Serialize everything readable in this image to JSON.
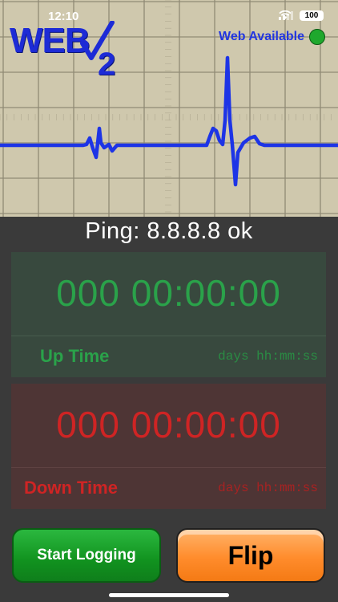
{
  "status_bar": {
    "time": "12:10",
    "battery": "100"
  },
  "header": {
    "logo_text": "WEB",
    "logo_subscript": "2",
    "web_status_label": "Web Available",
    "web_status_color": "#1fa82d"
  },
  "ping": {
    "text": "Ping: 8.8.8.8 ok"
  },
  "up_panel": {
    "value": "000 00:00:00",
    "label": "Up Time",
    "format": "days hh:mm:ss",
    "color": "#2aa24a"
  },
  "down_panel": {
    "value": "000 00:00:00",
    "label": "Down Time",
    "format": "days hh:mm:ss",
    "color": "#cf2424"
  },
  "buttons": {
    "start_label": "Start Logging",
    "flip_label": "Flip"
  },
  "icons": [
    "wifi-icon",
    "signal-icon",
    "battery-icon",
    "checkmark-icon",
    "status-dot"
  ]
}
